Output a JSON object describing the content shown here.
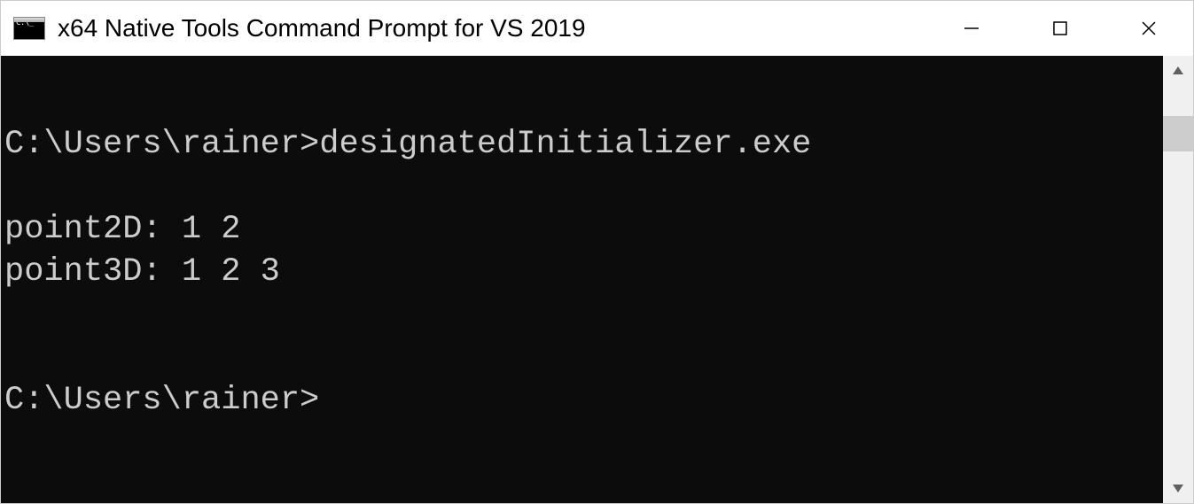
{
  "window": {
    "title": "x64 Native Tools Command Prompt for VS 2019"
  },
  "terminal": {
    "lines": [
      "",
      "C:\\Users\\rainer>designatedInitializer.exe",
      "",
      "point2D: 1 2",
      "point3D: 1 2 3",
      "",
      "",
      "C:\\Users\\rainer>"
    ]
  }
}
